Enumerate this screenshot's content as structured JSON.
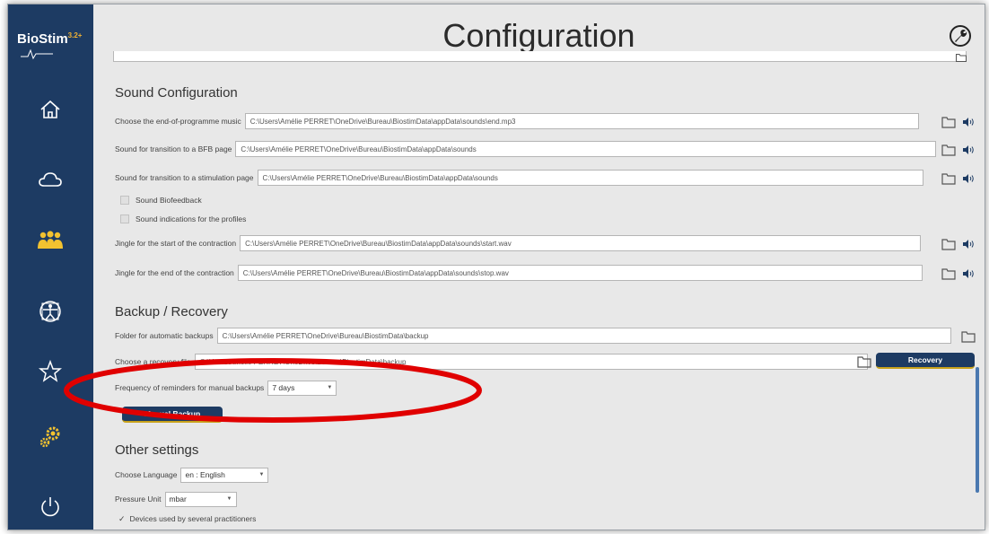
{
  "app": {
    "logo_text": "BioStim",
    "logo_version": "3.2+"
  },
  "page": {
    "title": "Configuration"
  },
  "sidebar": {
    "items": [
      {
        "icon": "home-icon"
      },
      {
        "icon": "cloud-icon"
      },
      {
        "icon": "users-icon"
      },
      {
        "icon": "vitruvian-man-icon"
      },
      {
        "icon": "star-icon"
      },
      {
        "icon": "gears-icon"
      },
      {
        "icon": "power-icon"
      }
    ]
  },
  "sound": {
    "title": "Sound Configuration",
    "rows": [
      {
        "label": "Choose the end-of-programme music",
        "value": "C:\\Users\\Amélie PERRET\\OneDrive\\Bureau\\BiostimData\\appData\\sounds\\end.mp3"
      },
      {
        "label": "Sound for transition to a BFB page",
        "value": "C:\\Users\\Amélie PERRET\\OneDrive\\Bureau\\BiostimData\\appData\\sounds"
      },
      {
        "label": "Sound for transition to a stimulation page",
        "value": "C:\\Users\\Amélie PERRET\\OneDrive\\Bureau\\BiostimData\\appData\\sounds"
      }
    ],
    "check_biofeedback": "Sound Biofeedback",
    "check_profiles": "Sound indications for the profiles",
    "jingle_start": {
      "label": "Jingle for the start of the contraction",
      "value": "C:\\Users\\Amélie PERRET\\OneDrive\\Bureau\\BiostimData\\appData\\sounds\\start.wav"
    },
    "jingle_end": {
      "label": "Jingle for the end of the contraction",
      "value": "C:\\Users\\Amélie PERRET\\OneDrive\\Bureau\\BiostimData\\appData\\sounds\\stop.wav"
    }
  },
  "backup": {
    "title": "Backup / Recovery",
    "folder_label": "Folder for automatic backups",
    "folder_value": "C:\\Users\\Amélie PERRET\\OneDrive\\Bureau\\BiostimData\\backup",
    "recovery_label": "Choose a recovery file",
    "recovery_value": "C:\\Users\\Amélie PERRET\\OneDrive\\Bureau\\BiostimData\\backup",
    "recovery_button": "Recovery",
    "frequency_label": "Frequency of reminders for manual backups",
    "frequency_value": "7 days",
    "manual_button": "Manual Backup"
  },
  "other": {
    "title": "Other settings",
    "language_label": "Choose Language",
    "language_value": "en : English",
    "pressure_label": "Pressure Unit",
    "pressure_value": "mbar",
    "devices_label": "Devices used by several practitioners"
  },
  "colors": {
    "sidebar": "#1d3b63",
    "accent": "#c8a21a",
    "annotation": "#e00000"
  }
}
